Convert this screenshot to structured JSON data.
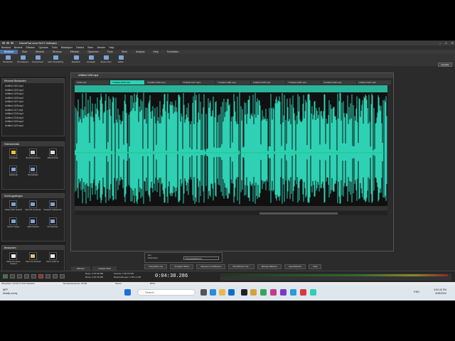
{
  "window": {
    "title": "WavePad door NCH Software",
    "controls": [
      "–",
      "□",
      "✕"
    ]
  },
  "menu": [
    "Bestand",
    "Bewerk",
    "Effecten",
    "Opname",
    "Tools",
    "Bladwijzer",
    "Gebied",
    "Stem",
    "Venster",
    "Help"
  ],
  "tabs": [
    "Bestand",
    "Start",
    "Bewerk",
    "Niveaus",
    "Effecten",
    "Opnemen",
    "Tools",
    "Stem",
    "Analyse",
    "Help",
    "Favorieten"
  ],
  "active_tab": "Bestand",
  "ribbon": [
    "Versterken",
    "Normaliseer",
    "Comprimeer",
    "Auto Versterking",
    "Equalizer",
    "vervagen",
    "Stereo Pan",
    "Editie"
  ],
  "upgrade_label": "Upgrade",
  "left": {
    "recent_header": "Recente Bestanden",
    "recent_files": [
      "Untitled 1421.mp4",
      "Untitled 1422.mp4",
      "Untitled 1425.mp4",
      "Untitled 1426.mp4",
      "Untitled 1427.mp4",
      "Untitled 1428.mp4",
      "Untitled 1117.mp4",
      "Untitled 1219.mp4",
      "Untitled 1318.mp4",
      "Untitled 1630.mp4",
      "Untitled 1420.mp4"
    ],
    "video_header": "Videotutorials",
    "video_tools": [
      "Introductie",
      "Bewerkingsmenu",
      "Effecttutorial",
      "Splitsende",
      "Behoeftelijst"
    ],
    "shortcut_header": "Snelkoppelingen",
    "shortcut_tools": [
      "Geluid audio bestand",
      "Intervals verwerken",
      "Verwijder audiosporen",
      "Samen voegen",
      "Splits bestand",
      "Nu bewerken"
    ],
    "files_header": "Bestanden",
    "files_tools": [
      "Maak een nieuw bestand",
      "Open een bestand",
      "Neem audio op"
    ]
  },
  "editor": {
    "title": "Untitled 1630.mp4",
    "file_tabs": [
      "1330.mp4",
      "*Untitled 1630.mp4",
      "*Untitled 1219.mp4",
      "*Untitled 1117.mp4",
      "*Untitled 1426.mp4",
      "Untitled 1428.mp4",
      "*Untitled 1425.mp4",
      "*Untitled 1422.mp4",
      "Untitled 1421.mp4"
    ],
    "active_file_tab": 1,
    "wave_color": "#2ed1b4"
  },
  "effects_panel": {
    "row1": "sec.",
    "row2": "Parameter",
    "select": "<Presetseffecten>"
  },
  "fx_buttons": [
    "Voeg Effect toe",
    "Verwijder Effect",
    "Afspelen met Effecten",
    "Pas Effecten toe...",
    "Bewaar Effecten",
    "Laad Effecten",
    "Help"
  ],
  "bottom_tabs": [
    "Effecten",
    "Untitled 1630"
  ],
  "status": {
    "start_label": "Begin:",
    "start_value": "0:04:38.286",
    "end_label": "Einde:",
    "end_value": "0:04:38.286",
    "sel_label": "Selectie:",
    "sel_value": "0:00:00.000",
    "dur_label": "Bestandslengte:",
    "dur_value": "0:05:13.136",
    "time": "0:04:38.286"
  },
  "app_status": [
    "WavePad v 19.00 © NCH Software",
    "Samplefrequentie: 44100",
    "Stereo",
    "BPM: -"
  ],
  "taskbar": {
    "search_placeholder": "Search",
    "weather_temp": "88°F",
    "weather_desc": "Mostly sunny",
    "lang": "ENG",
    "time": "4:52:40 PM",
    "date": "8/28/2024"
  }
}
